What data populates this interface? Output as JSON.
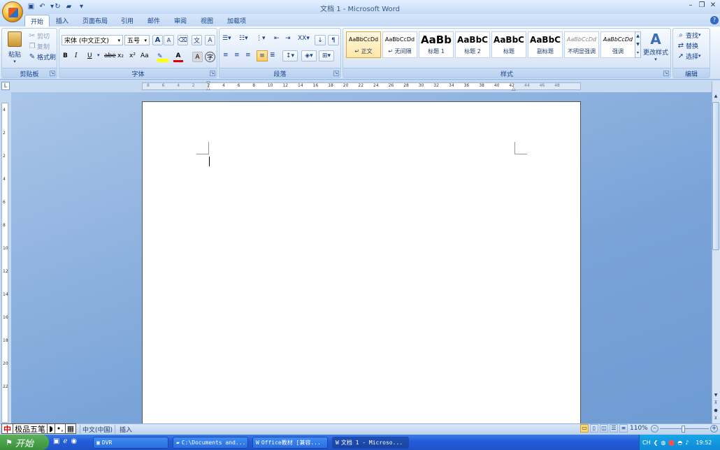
{
  "window": {
    "title": "文档 1 - Microsoft Word"
  },
  "tabs": [
    "开始",
    "插入",
    "页面布局",
    "引用",
    "邮件",
    "审阅",
    "视图",
    "加载项"
  ],
  "clipboard": {
    "paste": "粘贴",
    "cut": "剪切",
    "copy": "复制",
    "format_painter": "格式刷",
    "label": "剪贴板"
  },
  "font": {
    "name": "宋体 (中文正文)",
    "size": "五号",
    "label": "字体",
    "bold": "B",
    "italic": "I",
    "underline": "U",
    "strike": "abe",
    "sub": "x₂",
    "sup": "x²",
    "case": "Aa",
    "grow": "A",
    "shrink": "A",
    "color_a": "A",
    "border_a": "A"
  },
  "paragraph": {
    "label": "段落"
  },
  "styles": {
    "label": "样式",
    "change": "更改样式",
    "items": [
      {
        "sample": "AaBbCcDd",
        "name": "↵ 正文"
      },
      {
        "sample": "AaBbCcDd",
        "name": "↵ 无间隔"
      },
      {
        "sample": "AaBb",
        "name": "标题 1"
      },
      {
        "sample": "AaBbC",
        "name": "标题 2"
      },
      {
        "sample": "AaBbC",
        "name": "标题"
      },
      {
        "sample": "AaBbC",
        "name": "副标题"
      },
      {
        "sample": "AaBbCcDd",
        "name": "不明显强调"
      },
      {
        "sample": "AaBbCcDd",
        "name": "强调"
      }
    ]
  },
  "editing": {
    "find": "查找",
    "replace": "替换",
    "select": "选择",
    "label": "编辑"
  },
  "ruler": {
    "h_labels": [
      "8",
      "6",
      "4",
      "2",
      "2",
      "4",
      "6",
      "8",
      "10",
      "12",
      "14",
      "16",
      "18",
      "20",
      "22",
      "24",
      "26",
      "28",
      "30",
      "32",
      "34",
      "36",
      "38",
      "40",
      "42",
      "44",
      "46",
      "48"
    ],
    "v_labels": [
      "4",
      "2",
      "2",
      "4",
      "6",
      "8",
      "10",
      "12",
      "14",
      "16",
      "18",
      "20",
      "22"
    ]
  },
  "statusbar": {
    "ime": [
      "中",
      "极品五笔",
      "◗",
      "•,",
      "▦"
    ],
    "language": "中文(中国)",
    "mode": "插入",
    "zoom": "110%"
  },
  "taskbar": {
    "start": "开始",
    "buttons": [
      {
        "label": "DVR"
      },
      {
        "label": "C:\\Documents and..."
      },
      {
        "label": "Office教材 [兼容..."
      },
      {
        "label": "文档 1 - Microso..."
      }
    ],
    "tray_lang": "CH",
    "clock": "19:52"
  }
}
